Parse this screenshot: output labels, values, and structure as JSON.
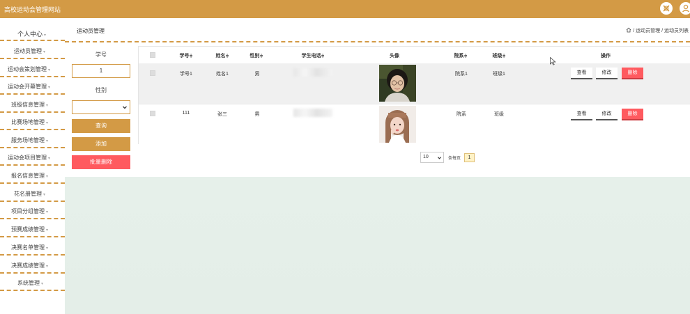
{
  "app": {
    "title": "高校运动会管理网站"
  },
  "topbar": {
    "icons": [
      "close-x-icon",
      "user-icon"
    ]
  },
  "sidebar": {
    "header": "个人中心",
    "items": [
      {
        "label": "运动员管理"
      },
      {
        "label": "运动会策划管理"
      },
      {
        "label": "运动会开幕管理"
      },
      {
        "label": "班级信息管理"
      },
      {
        "label": "比赛场地管理"
      },
      {
        "label": "服务场地管理"
      },
      {
        "label": "运动会项目管理"
      },
      {
        "label": "报名信息管理"
      },
      {
        "label": "花名册管理"
      },
      {
        "label": "项目分组管理"
      },
      {
        "label": "预赛成绩管理"
      },
      {
        "label": "决赛名单管理"
      },
      {
        "label": "决赛成绩管理"
      },
      {
        "label": "系统管理"
      }
    ],
    "caret": "▾"
  },
  "page": {
    "title": "运动员管理",
    "breadcrumb": " / 运动员管理 / 运动员列表"
  },
  "filters": {
    "id_label": "学号",
    "id_value": "1",
    "gender_label": "性别",
    "gender_value": "",
    "search_label": "查询",
    "add_label": "添加",
    "batch_delete_label": "批量删除"
  },
  "table": {
    "columns": [
      "学号",
      "姓名",
      "性别",
      "学生电话",
      "头像",
      "院系",
      "班级",
      "操作"
    ],
    "sort_mark": "≑",
    "rows": [
      {
        "id": "学号1",
        "name": "姓名1",
        "gender": "男",
        "phone": "",
        "avatar": "photo-short-hair-glasses",
        "dept": "院系1",
        "class": "班级1"
      },
      {
        "id": "111",
        "name": "张三",
        "gender": "男",
        "phone": "",
        "avatar": "photo-long-hair-girl",
        "dept": "院系",
        "class": "班级"
      }
    ],
    "actions": {
      "view": "查看",
      "edit": "修改",
      "delete": "删除"
    }
  },
  "pagination": {
    "page_size": "10",
    "page_size_label": "条每页",
    "current_page": "1"
  },
  "colors": {
    "accent": "#d39a45",
    "danger": "#ff5a5f",
    "bottom_bg": "#e5efe9"
  }
}
